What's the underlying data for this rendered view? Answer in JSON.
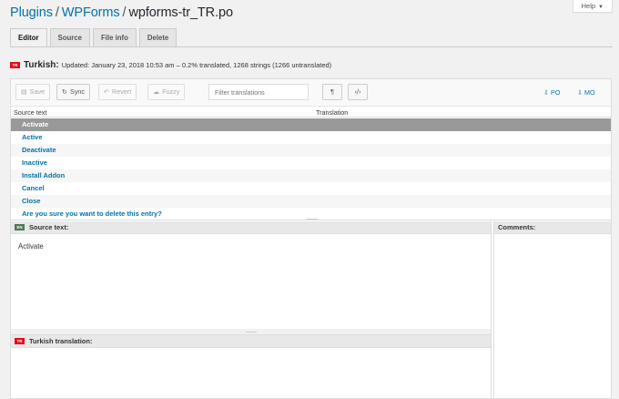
{
  "header": {
    "help_label": "Help",
    "help_caret": "▼",
    "crumbs": [
      "Plugins",
      "WPForms",
      "wpforms-tr_TR.po"
    ],
    "separator": "/"
  },
  "tabs": [
    {
      "label": "Editor",
      "active": true
    },
    {
      "label": "Source",
      "active": false
    },
    {
      "label": "File info",
      "active": false
    },
    {
      "label": "Delete",
      "active": false
    }
  ],
  "status": {
    "flag_code": "TR",
    "language": "Turkish:",
    "details": "Updated: January 23, 2018 10:53 am – 0.2% translated, 1268 strings (1266 untranslated)"
  },
  "toolbar": {
    "save": {
      "icon": "▤",
      "label": "Save"
    },
    "sync": {
      "icon": "↻",
      "label": "Sync"
    },
    "revert": {
      "icon": "↶",
      "label": "Revert"
    },
    "fuzzy": {
      "icon": "☁",
      "label": "Fuzzy"
    },
    "filter_placeholder": "Filter translations",
    "pilcrow": "¶",
    "code": "‹/›",
    "download_po": {
      "icon": "⇩",
      "label": "PO"
    },
    "download_mo": {
      "icon": "⇩",
      "label": "MO"
    }
  },
  "table": {
    "col_source": "Source text",
    "col_translation": "Translation",
    "rows": [
      "Activate",
      "Active",
      "Deactivate",
      "Inactive",
      "Install Addon",
      "Cancel",
      "Close",
      "Are you sure you want to delete this entry?"
    ],
    "selected_index": 0
  },
  "source_pane": {
    "flag_code": "EN",
    "title": "Source text:",
    "text": "Activate"
  },
  "comments_pane": {
    "title": "Comments:"
  },
  "translation_pane": {
    "flag_code": "TR",
    "title": "Turkish translation:"
  },
  "colors": {
    "link": "#0073aa",
    "selected_row": "#999999",
    "turkish_flag": "#e30a17"
  }
}
